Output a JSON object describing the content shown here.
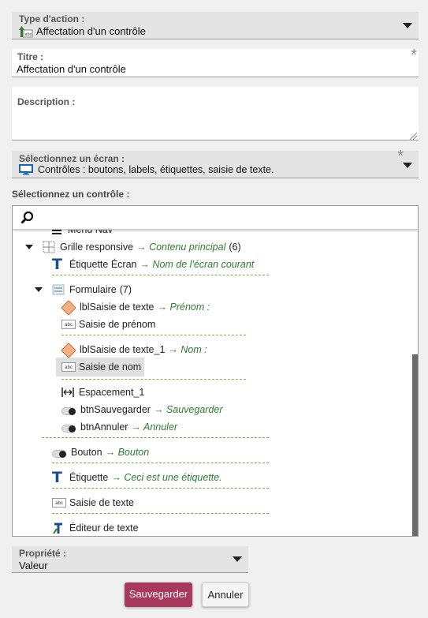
{
  "action_type": {
    "label": "Type d'action :",
    "value": "Affectation d'un contrôle"
  },
  "title_field": {
    "label": "Titre :",
    "value": "Affectation d'un contrôle",
    "required_mark": "*"
  },
  "description_field": {
    "label": "Description :",
    "value": ""
  },
  "screen_select": {
    "label": "Sélectionnez un écran :",
    "value": "Contrôles : boutons, labels, étiquettes, saisie de texte.",
    "required_mark": "*"
  },
  "control_picker": {
    "label": "Sélectionnez un contrôle :",
    "search_placeholder": "",
    "tree": [
      {
        "label": "Menu Nav",
        "icon": "hamburger-icon"
      },
      {
        "label": "Grille responsive",
        "target": "→ Contenu principal",
        "count": "(6)",
        "icon": "grid-icon",
        "expanded": true
      },
      {
        "label": "Étiquette Écran",
        "target": "→ Nom de l'écran courant",
        "icon": "text-label-icon"
      },
      {
        "label": "Formulaire",
        "count": "(7)",
        "icon": "form-icon",
        "expanded": true
      },
      {
        "label": "lblSaisie de texte",
        "target": "→ Prénom :",
        "icon": "tag-icon"
      },
      {
        "label": "Saisie de prénom",
        "icon": "text-input-icon"
      },
      {
        "label": "lblSaisie de texte_1",
        "target": "→ Nom :",
        "icon": "tag-icon"
      },
      {
        "label": "Saisie de nom",
        "icon": "text-input-icon",
        "selected": true
      },
      {
        "label": "Espacement_1",
        "icon": "spacer-icon"
      },
      {
        "label": "btnSauvegarder",
        "target": "→ Sauvegarder",
        "icon": "toggle-icon"
      },
      {
        "label": "btnAnnuler",
        "target": "→ Annuler",
        "icon": "toggle-icon"
      },
      {
        "label": "Bouton",
        "target": "→ Bouton",
        "icon": "toggle-icon"
      },
      {
        "label": "Étiquette",
        "target": "→ Ceci est une étiquette.",
        "icon": "text-label-icon"
      },
      {
        "label": "Saisie de texte",
        "icon": "text-input-icon"
      },
      {
        "label": "Éditeur de texte",
        "icon": "text-editor-icon"
      }
    ]
  },
  "property_select": {
    "label": "Propriété :",
    "value": "Valeur"
  },
  "buttons": {
    "save": "Sauvegarder",
    "cancel": "Annuler"
  },
  "colors": {
    "primary": "#a8385e",
    "accent_green": "#2e7d32",
    "separator": "#7cb342",
    "screen_icon": "#1565c0"
  },
  "text_icon_text": "abc"
}
